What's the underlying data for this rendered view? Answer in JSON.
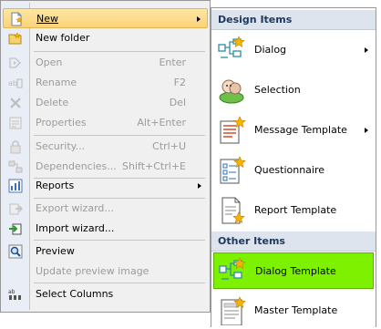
{
  "context_menu": {
    "items": [
      {
        "label": "New",
        "shortcut": "",
        "has_submenu": true,
        "enabled": true,
        "highlighted": true,
        "icon": "new-document-icon"
      },
      {
        "label": "New folder",
        "shortcut": "",
        "enabled": true,
        "icon": "new-folder-icon"
      },
      {
        "label": "Open",
        "shortcut": "Enter",
        "enabled": false,
        "icon": "open-icon"
      },
      {
        "label": "Rename",
        "shortcut": "F2",
        "enabled": false,
        "icon": "rename-icon"
      },
      {
        "label": "Delete",
        "shortcut": "Del",
        "enabled": false,
        "icon": "delete-icon"
      },
      {
        "label": "Properties",
        "shortcut": "Alt+Enter",
        "enabled": false,
        "icon": "properties-icon"
      },
      {
        "label": "Security...",
        "shortcut": "Ctrl+U",
        "enabled": false,
        "icon": "lock-icon"
      },
      {
        "label": "Dependencies...",
        "shortcut": "Shift+Ctrl+E",
        "enabled": false,
        "icon": "dependencies-icon"
      },
      {
        "label": "Reports",
        "shortcut": "",
        "has_submenu": true,
        "enabled": true,
        "icon": "reports-icon"
      },
      {
        "label": "Export wizard...",
        "shortcut": "",
        "enabled": false,
        "icon": "export-icon"
      },
      {
        "label": "Import wizard...",
        "shortcut": "",
        "enabled": true,
        "icon": "import-icon"
      },
      {
        "label": "Preview",
        "shortcut": "",
        "enabled": true,
        "icon": "preview-icon"
      },
      {
        "label": "Update preview image",
        "shortcut": "",
        "enabled": false,
        "icon": ""
      },
      {
        "label": "Select Columns",
        "shortcut": "",
        "enabled": true,
        "icon": "columns-icon"
      }
    ]
  },
  "submenu": {
    "design_header": "Design Items",
    "design_items": [
      {
        "label": "Dialog",
        "has_submenu": true,
        "icon": "dialog-icon"
      },
      {
        "label": "Selection",
        "icon": "selection-icon"
      },
      {
        "label": "Message Template",
        "has_submenu": true,
        "icon": "message-template-icon"
      },
      {
        "label": "Questionnaire",
        "icon": "questionnaire-icon"
      },
      {
        "label": "Report Template",
        "icon": "report-template-icon"
      }
    ],
    "other_header": "Other Items",
    "other_items": [
      {
        "label": "Dialog Template",
        "selected": true,
        "icon": "dialog-template-icon"
      },
      {
        "label": "Master Template",
        "icon": "master-template-icon"
      }
    ]
  },
  "colors": {
    "highlight": "#fbd37a",
    "selected": "#7ef100",
    "header_bg": "#dde4ee"
  }
}
